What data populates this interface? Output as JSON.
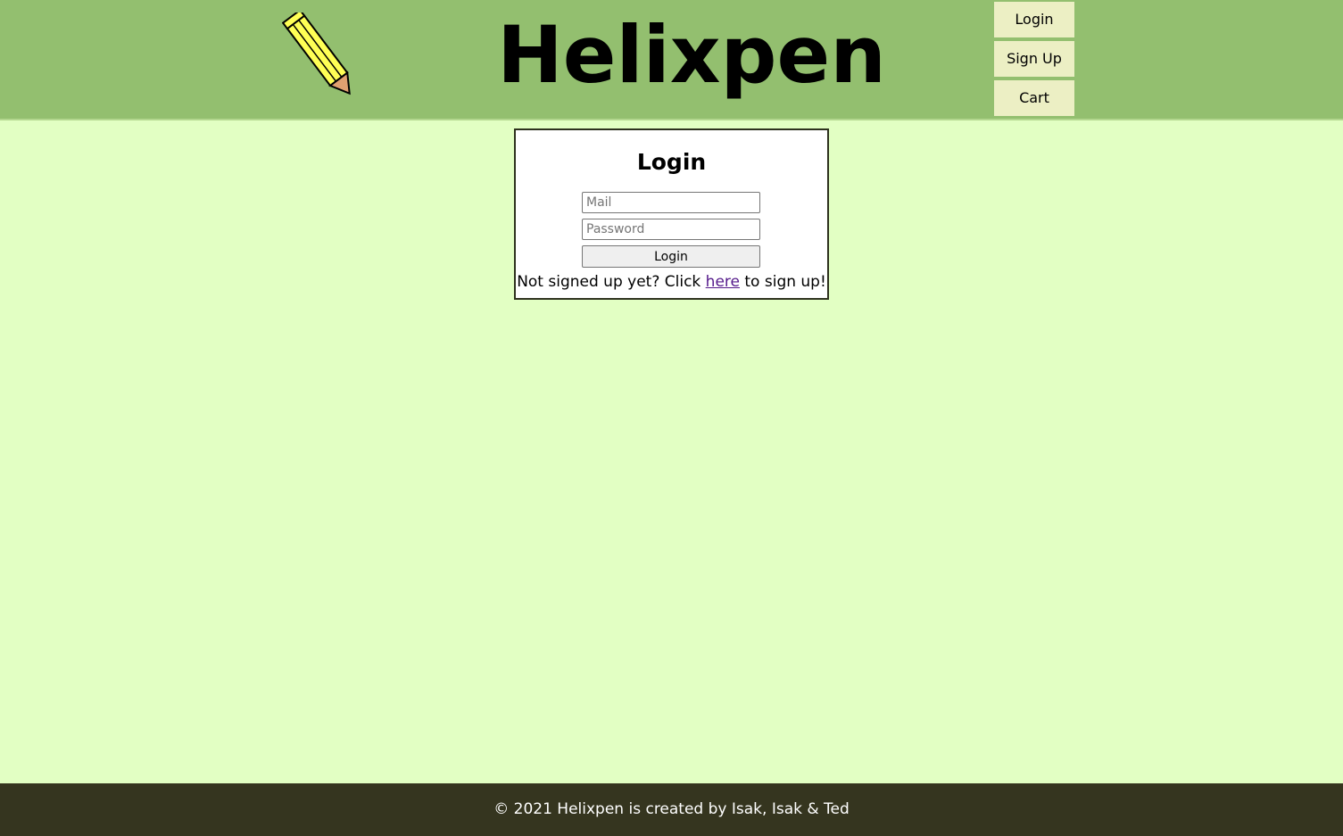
{
  "header": {
    "title": "Helixpen",
    "logo_icon": "pencil-icon",
    "background_color": "#93bf6f",
    "nav": {
      "login_label": "Login",
      "signup_label": "Sign Up",
      "cart_label": "Cart"
    }
  },
  "login_form": {
    "title": "Login",
    "mail_placeholder": "Mail",
    "password_placeholder": "Password",
    "submit_label": "Login",
    "signup_prompt_before": "Not signed up yet? Click ",
    "signup_link": "here",
    "signup_prompt_after": " to sign up!"
  },
  "footer": {
    "text": "© 2021 Helixpen is created by Isak, Isak & Ted",
    "background_color": "#35351f"
  },
  "colors": {
    "page_background": "#e2ffc3",
    "nav_button": "#ecefc4",
    "link": "#551a8b"
  }
}
